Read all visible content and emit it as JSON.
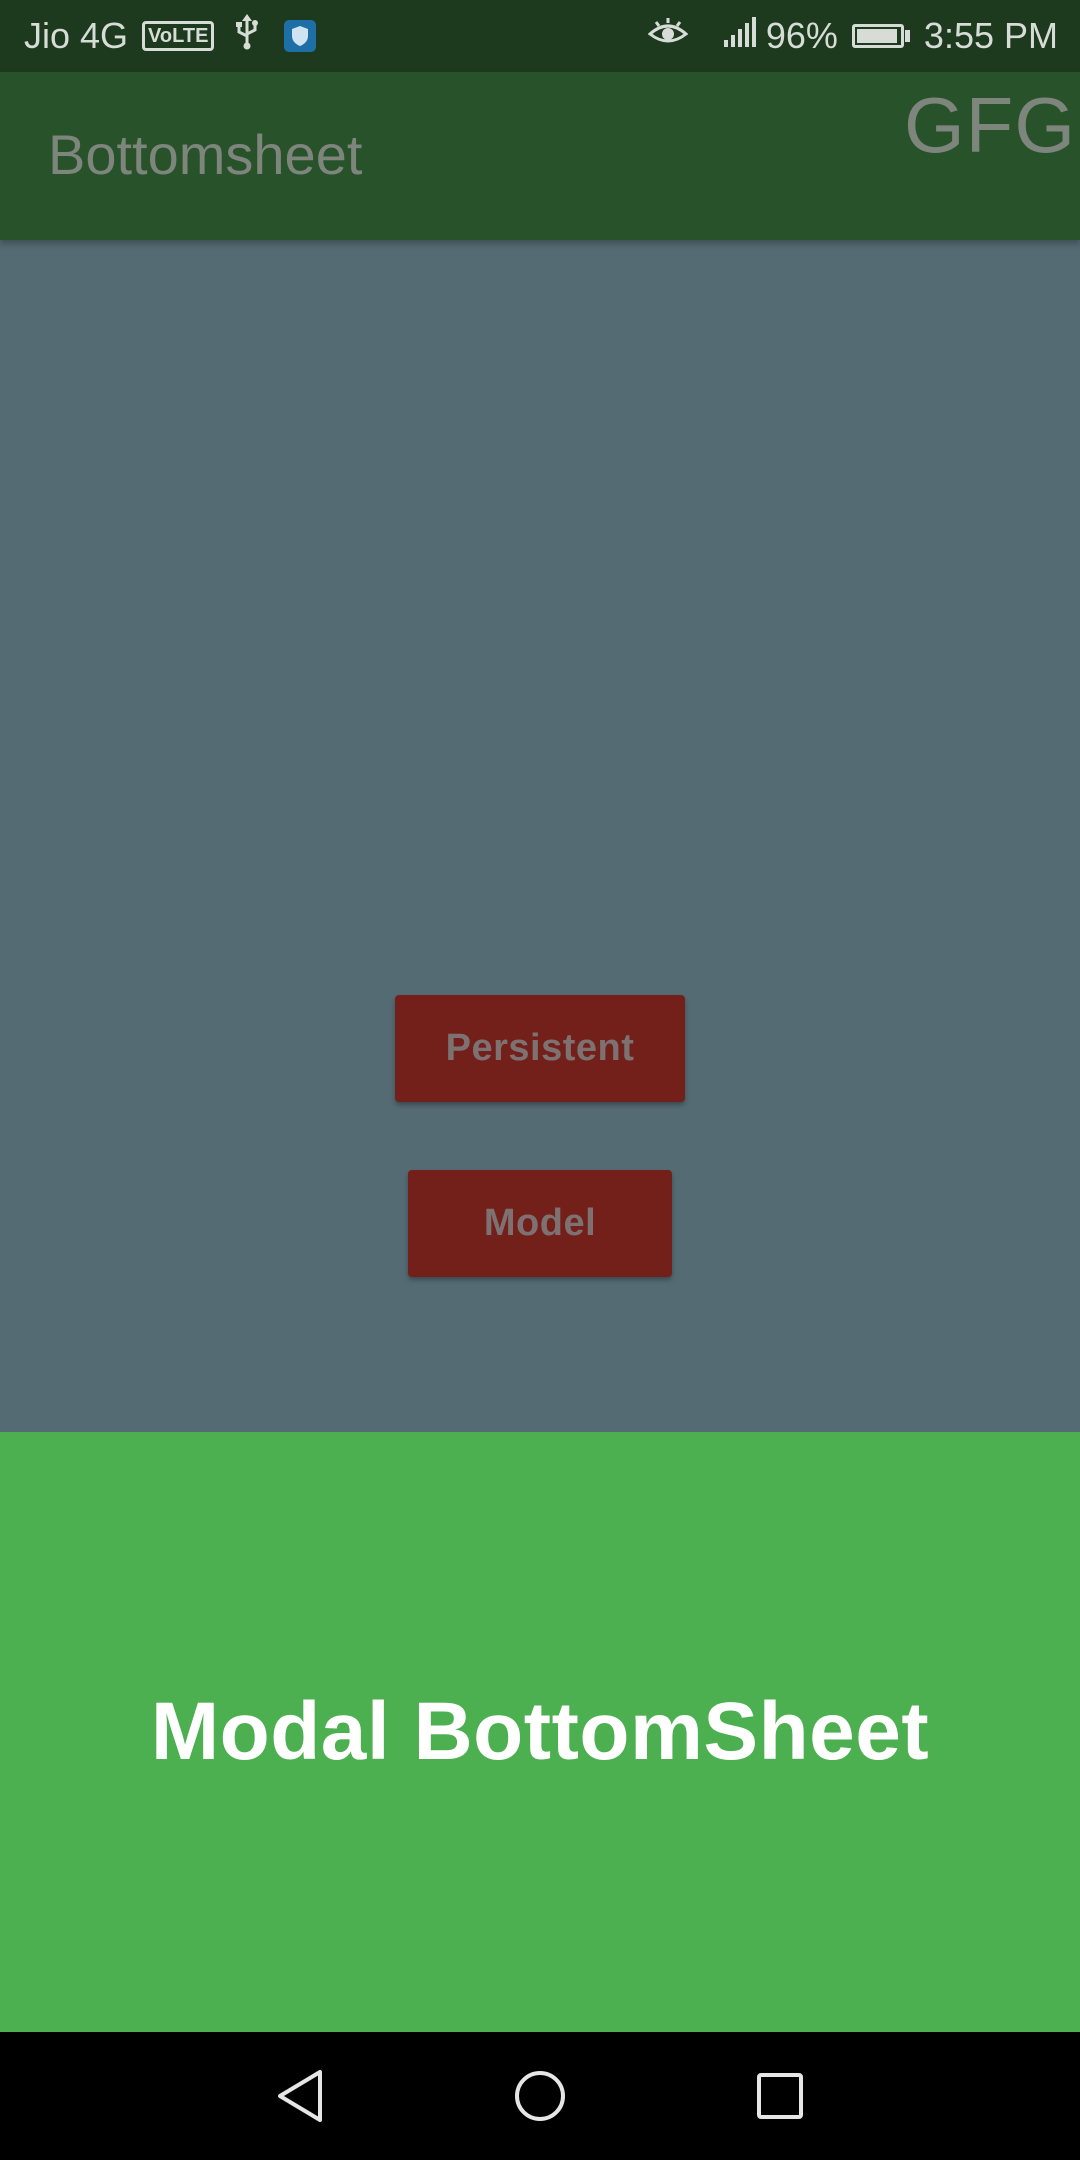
{
  "status_bar": {
    "carrier": "Jio 4G",
    "volte": "VoLTE",
    "battery_percent": "96%",
    "battery_level": 0.96,
    "time": "3:55 PM",
    "icons": [
      "usb-icon",
      "shield-icon",
      "eye-icon",
      "signal-icon",
      "battery-icon"
    ]
  },
  "app_bar": {
    "title": "Bottomsheet",
    "brand": "GFG"
  },
  "content": {
    "buttons": {
      "persistent_label": "Persistent",
      "model_label": "Model"
    }
  },
  "bottom_sheet": {
    "text": "Modal BottomSheet"
  },
  "nav_bar": {
    "icons": [
      "back-icon",
      "home-icon",
      "recents-icon"
    ]
  },
  "colors": {
    "status_bar": "#1d3a1f",
    "app_bar": "#27522a",
    "scrim_content": "#546b74",
    "button": "#73201b",
    "bottom_sheet": "#4caf50",
    "nav_bar": "#000000"
  }
}
